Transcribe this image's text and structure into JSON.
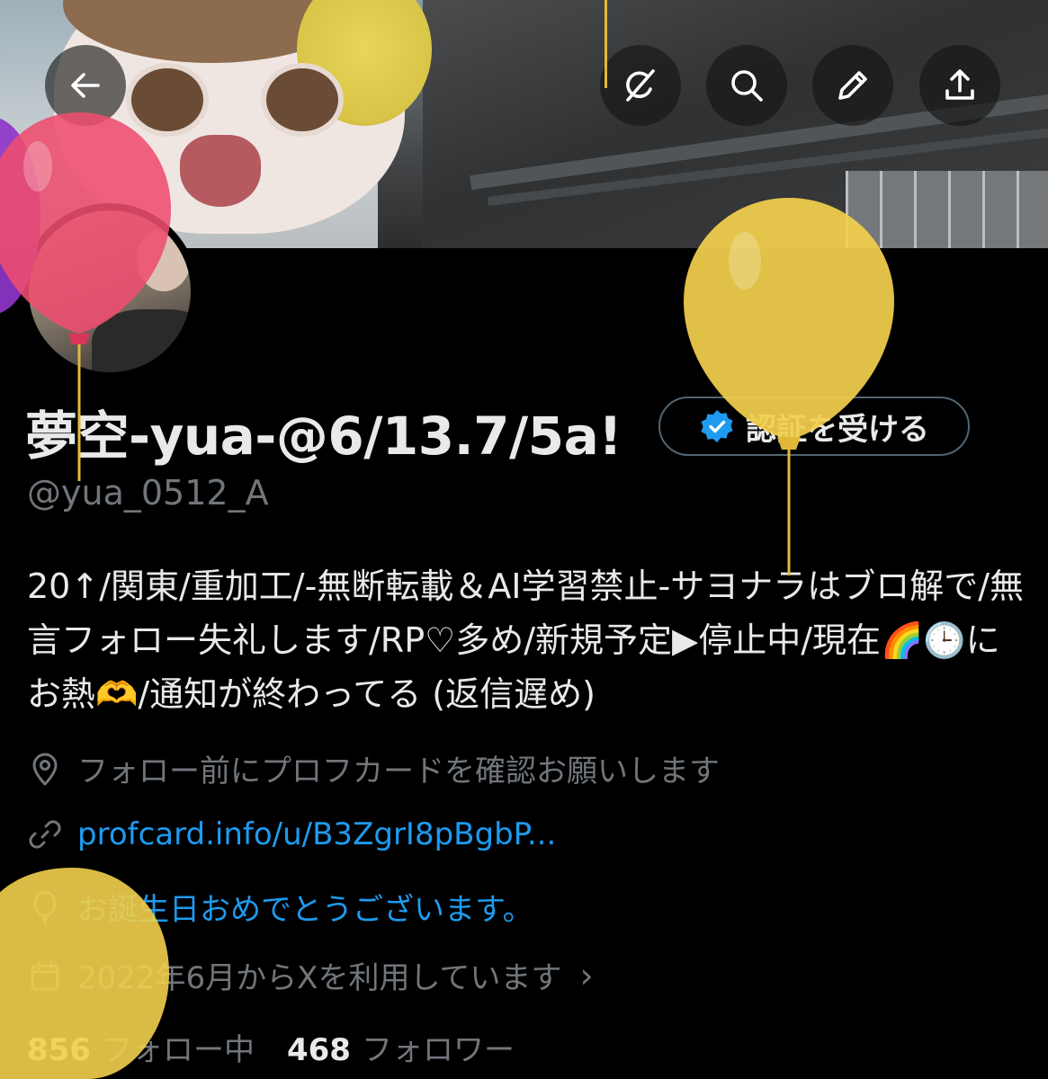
{
  "toolbar": {
    "back_label": "Back",
    "grok_label": "Grok",
    "search_label": "Search",
    "edit_label": "Edit",
    "share_label": "Share"
  },
  "profile": {
    "display_name": "夢空-yua-@6/13.7/5a!",
    "verify_button": "認証を受ける",
    "handle": "@yua_0512_A",
    "bio": "20↑/関東/重加工/-無断転載＆AI学習禁止-サヨナラはブロ解で/無言フォロー失礼します/RP♡多め/新規予定▶停止中/現在🌈🕒にお熱🫶/通知が終わってる (返信遅め)",
    "location": "フォロー前にプロフカードを確認お願いします",
    "website": "profcard.info/u/B3ZgrI8pBgbP...",
    "birthday": "お誕生日おめでとうございます。",
    "joined": "2022年6月からXを利用しています",
    "following_count": "856",
    "following_label": "フォロー中",
    "followers_count": "468",
    "followers_label": "フォロワー"
  },
  "colors": {
    "background": "#000000",
    "text_primary": "#e7e9ea",
    "text_secondary": "#71767b",
    "link": "#1d9bf0",
    "verified_badge": "#1d9bf0",
    "balloon_pink": "#ee4d6e",
    "balloon_yellow": "#f2cf4c",
    "balloon_purple": "#8e35c8"
  },
  "icons": {
    "back": "arrow-left-icon",
    "grok": "grok-icon",
    "search": "search-icon",
    "edit": "pencil-icon",
    "share": "share-icon",
    "verified": "verified-badge-icon",
    "location": "location-pin-icon",
    "website": "link-icon",
    "birthday": "balloon-icon",
    "joined": "calendar-icon"
  }
}
